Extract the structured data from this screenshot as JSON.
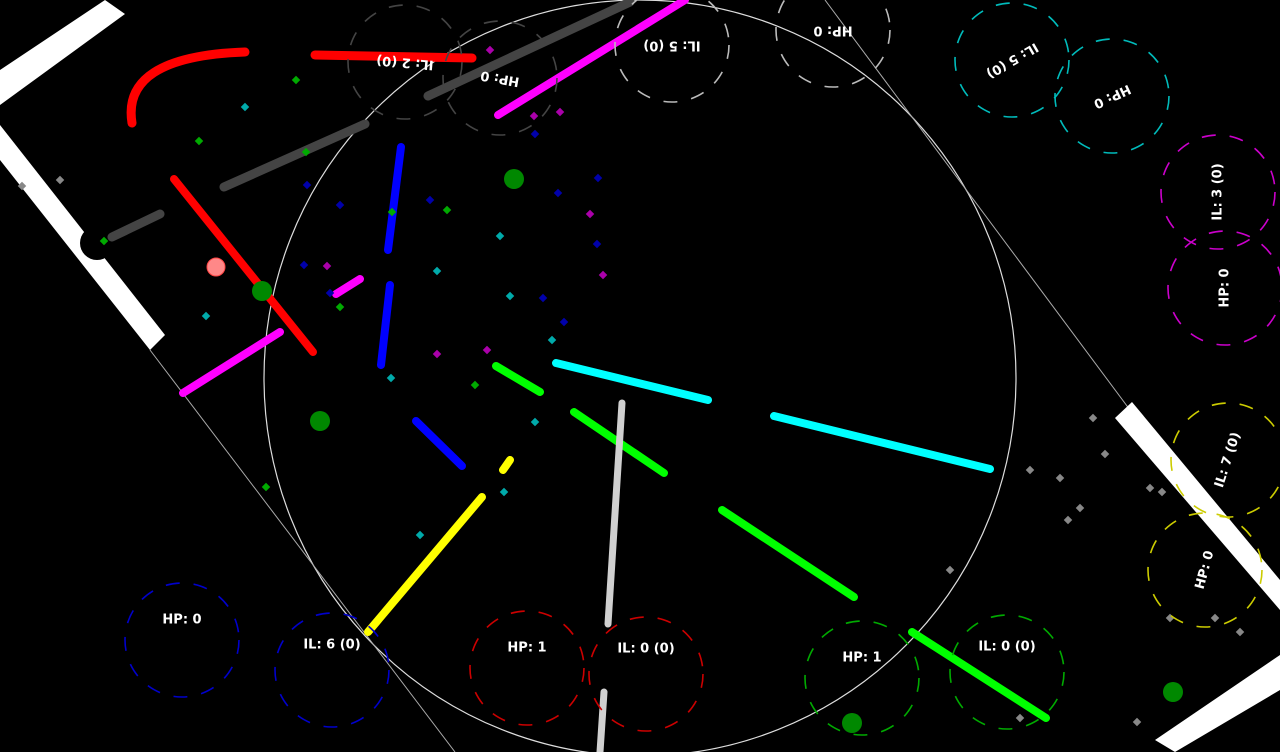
{
  "colors": {
    "background": "#000000",
    "blue": "#0000ff",
    "red": "#ff0000",
    "green": "#00ff00",
    "yellow": "#ffff00",
    "magenta": "#ff00ff",
    "cyan": "#00ffff",
    "light_gray": "#d0d0d0",
    "dark_gray": "#444444",
    "wall": "#ffffff"
  },
  "players": [
    {
      "color": "blue",
      "hp_label": "HP: 0",
      "il_label": "IL: 6 (0)"
    },
    {
      "color": "red",
      "hp_label": "HP: 1",
      "il_label": "IL: 0 (0)"
    },
    {
      "color": "green",
      "hp_label": "HP: 1",
      "il_label": "IL: 0 (0)"
    },
    {
      "color": "yellow",
      "hp_label": "HP: 0",
      "il_label": "IL: 7 (0)"
    },
    {
      "color": "magenta",
      "hp_label": "HP: 0",
      "il_label": "IL: 3 (0)"
    },
    {
      "color": "cyan",
      "hp_label": "HP: 0",
      "il_label": "IL: 5 (0)"
    },
    {
      "color": "light_gray",
      "hp_label": "HP: 0",
      "il_label": "IL: 5 (0)"
    },
    {
      "color": "dark_gray",
      "hp_label": "HP: 0",
      "il_label": "IL: 2 (0)"
    }
  ]
}
